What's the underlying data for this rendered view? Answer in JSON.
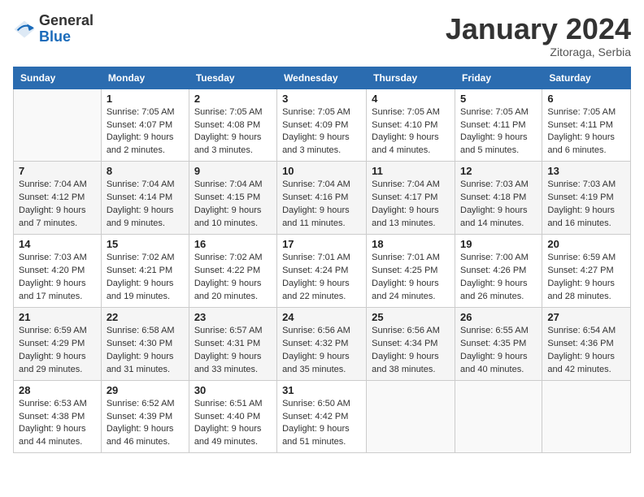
{
  "header": {
    "logo_general": "General",
    "logo_blue": "Blue",
    "month_title": "January 2024",
    "subtitle": "Zitoraga, Serbia"
  },
  "days_of_week": [
    "Sunday",
    "Monday",
    "Tuesday",
    "Wednesday",
    "Thursday",
    "Friday",
    "Saturday"
  ],
  "weeks": [
    [
      {
        "day": "",
        "info": ""
      },
      {
        "day": "1",
        "info": "Sunrise: 7:05 AM\nSunset: 4:07 PM\nDaylight: 9 hours\nand 2 minutes."
      },
      {
        "day": "2",
        "info": "Sunrise: 7:05 AM\nSunset: 4:08 PM\nDaylight: 9 hours\nand 3 minutes."
      },
      {
        "day": "3",
        "info": "Sunrise: 7:05 AM\nSunset: 4:09 PM\nDaylight: 9 hours\nand 3 minutes."
      },
      {
        "day": "4",
        "info": "Sunrise: 7:05 AM\nSunset: 4:10 PM\nDaylight: 9 hours\nand 4 minutes."
      },
      {
        "day": "5",
        "info": "Sunrise: 7:05 AM\nSunset: 4:11 PM\nDaylight: 9 hours\nand 5 minutes."
      },
      {
        "day": "6",
        "info": "Sunrise: 7:05 AM\nSunset: 4:11 PM\nDaylight: 9 hours\nand 6 minutes."
      }
    ],
    [
      {
        "day": "7",
        "info": "Sunrise: 7:04 AM\nSunset: 4:12 PM\nDaylight: 9 hours\nand 7 minutes."
      },
      {
        "day": "8",
        "info": "Sunrise: 7:04 AM\nSunset: 4:14 PM\nDaylight: 9 hours\nand 9 minutes."
      },
      {
        "day": "9",
        "info": "Sunrise: 7:04 AM\nSunset: 4:15 PM\nDaylight: 9 hours\nand 10 minutes."
      },
      {
        "day": "10",
        "info": "Sunrise: 7:04 AM\nSunset: 4:16 PM\nDaylight: 9 hours\nand 11 minutes."
      },
      {
        "day": "11",
        "info": "Sunrise: 7:04 AM\nSunset: 4:17 PM\nDaylight: 9 hours\nand 13 minutes."
      },
      {
        "day": "12",
        "info": "Sunrise: 7:03 AM\nSunset: 4:18 PM\nDaylight: 9 hours\nand 14 minutes."
      },
      {
        "day": "13",
        "info": "Sunrise: 7:03 AM\nSunset: 4:19 PM\nDaylight: 9 hours\nand 16 minutes."
      }
    ],
    [
      {
        "day": "14",
        "info": "Sunrise: 7:03 AM\nSunset: 4:20 PM\nDaylight: 9 hours\nand 17 minutes."
      },
      {
        "day": "15",
        "info": "Sunrise: 7:02 AM\nSunset: 4:21 PM\nDaylight: 9 hours\nand 19 minutes."
      },
      {
        "day": "16",
        "info": "Sunrise: 7:02 AM\nSunset: 4:22 PM\nDaylight: 9 hours\nand 20 minutes."
      },
      {
        "day": "17",
        "info": "Sunrise: 7:01 AM\nSunset: 4:24 PM\nDaylight: 9 hours\nand 22 minutes."
      },
      {
        "day": "18",
        "info": "Sunrise: 7:01 AM\nSunset: 4:25 PM\nDaylight: 9 hours\nand 24 minutes."
      },
      {
        "day": "19",
        "info": "Sunrise: 7:00 AM\nSunset: 4:26 PM\nDaylight: 9 hours\nand 26 minutes."
      },
      {
        "day": "20",
        "info": "Sunrise: 6:59 AM\nSunset: 4:27 PM\nDaylight: 9 hours\nand 28 minutes."
      }
    ],
    [
      {
        "day": "21",
        "info": "Sunrise: 6:59 AM\nSunset: 4:29 PM\nDaylight: 9 hours\nand 29 minutes."
      },
      {
        "day": "22",
        "info": "Sunrise: 6:58 AM\nSunset: 4:30 PM\nDaylight: 9 hours\nand 31 minutes."
      },
      {
        "day": "23",
        "info": "Sunrise: 6:57 AM\nSunset: 4:31 PM\nDaylight: 9 hours\nand 33 minutes."
      },
      {
        "day": "24",
        "info": "Sunrise: 6:56 AM\nSunset: 4:32 PM\nDaylight: 9 hours\nand 35 minutes."
      },
      {
        "day": "25",
        "info": "Sunrise: 6:56 AM\nSunset: 4:34 PM\nDaylight: 9 hours\nand 38 minutes."
      },
      {
        "day": "26",
        "info": "Sunrise: 6:55 AM\nSunset: 4:35 PM\nDaylight: 9 hours\nand 40 minutes."
      },
      {
        "day": "27",
        "info": "Sunrise: 6:54 AM\nSunset: 4:36 PM\nDaylight: 9 hours\nand 42 minutes."
      }
    ],
    [
      {
        "day": "28",
        "info": "Sunrise: 6:53 AM\nSunset: 4:38 PM\nDaylight: 9 hours\nand 44 minutes."
      },
      {
        "day": "29",
        "info": "Sunrise: 6:52 AM\nSunset: 4:39 PM\nDaylight: 9 hours\nand 46 minutes."
      },
      {
        "day": "30",
        "info": "Sunrise: 6:51 AM\nSunset: 4:40 PM\nDaylight: 9 hours\nand 49 minutes."
      },
      {
        "day": "31",
        "info": "Sunrise: 6:50 AM\nSunset: 4:42 PM\nDaylight: 9 hours\nand 51 minutes."
      },
      {
        "day": "",
        "info": ""
      },
      {
        "day": "",
        "info": ""
      },
      {
        "day": "",
        "info": ""
      }
    ]
  ]
}
